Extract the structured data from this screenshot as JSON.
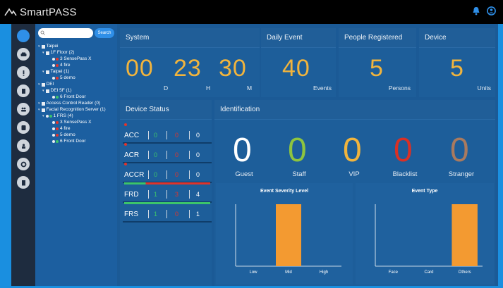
{
  "app": {
    "title": "SmartPASS"
  },
  "colors": {
    "accent": "#f1b43d",
    "zero": "#ffffff",
    "staff": "#8dc43f",
    "vip": "#f1b43d",
    "blacklist": "#d93025",
    "stranger": "#a97a5f",
    "bar": "#f39a31",
    "topbar_bg": "#000000",
    "sidebar_bg": "#1e2c3f"
  },
  "sidebar_icons": [
    "home-icon",
    "car-icon",
    "alert-icon",
    "document-icon",
    "users-icon",
    "id-card-icon",
    "visitor-icon",
    "settings-icon",
    "building-icon"
  ],
  "search": {
    "placeholder": "",
    "button_label": "Search"
  },
  "tree": [
    {
      "label": "Taipei",
      "depth": 0,
      "icon": "building-icon"
    },
    {
      "label": "1F Floor (2)",
      "depth": 1,
      "icon": "door-icon"
    },
    {
      "label": "3 SensePass X",
      "depth": 2,
      "icon": "dot-red"
    },
    {
      "label": "4 fire",
      "depth": 2,
      "icon": "dot-red"
    },
    {
      "label": "Taipei (1)",
      "depth": 1,
      "icon": "door-icon"
    },
    {
      "label": "5 demo",
      "depth": 2,
      "icon": "dot-red"
    },
    {
      "label": "DEI",
      "depth": 0,
      "icon": "building-icon"
    },
    {
      "label": "DEI 5F (1)",
      "depth": 1,
      "icon": "door-icon"
    },
    {
      "label": "6 Front Door",
      "depth": 2,
      "icon": "dot-green"
    },
    {
      "label": "Access Control Reader (0)",
      "depth": 0,
      "icon": "reader-icon"
    },
    {
      "label": "Facial Recognition Server (1)",
      "depth": 0,
      "icon": "server-icon"
    },
    {
      "label": "1 FRS (4)",
      "depth": 1,
      "icon": "server-green"
    },
    {
      "label": "3 SensePass X",
      "depth": 2,
      "icon": "dot-red"
    },
    {
      "label": "4 fire",
      "depth": 2,
      "icon": "dot-red"
    },
    {
      "label": "5 demo",
      "depth": 2,
      "icon": "dot-red"
    },
    {
      "label": "6 Front Door",
      "depth": 2,
      "icon": "dot-green"
    }
  ],
  "system": {
    "title": "System",
    "days": "00",
    "hours": "23",
    "minutes": "30",
    "d_label": "D",
    "h_label": "H",
    "m_label": "M"
  },
  "daily_event": {
    "title": "Daily Event",
    "value": "40",
    "unit": "Events"
  },
  "people": {
    "title": "People Registered",
    "value": "5",
    "unit": "Persons"
  },
  "device": {
    "title": "Device",
    "value": "5",
    "unit": "Units"
  },
  "device_status": {
    "title": "Device Status",
    "rows": [
      {
        "name": "ACC",
        "online": "0",
        "offline": "0",
        "total": "0",
        "bar": "none"
      },
      {
        "name": "ACR",
        "online": "0",
        "offline": "0",
        "total": "0",
        "bar": "none"
      },
      {
        "name": "ACCR",
        "online": "0",
        "offline": "0",
        "total": "0",
        "bar": "none"
      },
      {
        "name": "FRD",
        "online": "1",
        "offline": "3",
        "total": "4",
        "bar": "mixed"
      },
      {
        "name": "FRS",
        "online": "1",
        "offline": "0",
        "total": "1",
        "bar": "green"
      }
    ]
  },
  "identification": {
    "title": "Identification",
    "items": [
      {
        "label": "Guest",
        "value": "0",
        "color": "#ffffff"
      },
      {
        "label": "Staff",
        "value": "0",
        "color": "#8dc43f"
      },
      {
        "label": "VIP",
        "value": "0",
        "color": "#f1b43d"
      },
      {
        "label": "Blacklist",
        "value": "0",
        "color": "#d93025"
      },
      {
        "label": "Stranger",
        "value": "0",
        "color": "#a97a5f"
      }
    ]
  },
  "chart_data": [
    {
      "type": "bar",
      "title": "Event Severity Level",
      "categories": [
        "Low",
        "Mid",
        "High"
      ],
      "values": [
        0,
        40,
        0
      ],
      "ylim": [
        0,
        40
      ],
      "grid": false
    },
    {
      "type": "bar",
      "title": "Event Type",
      "categories": [
        "Face",
        "Card",
        "Others"
      ],
      "values": [
        0,
        0,
        40
      ],
      "ylim": [
        0,
        40
      ],
      "grid": false
    }
  ]
}
